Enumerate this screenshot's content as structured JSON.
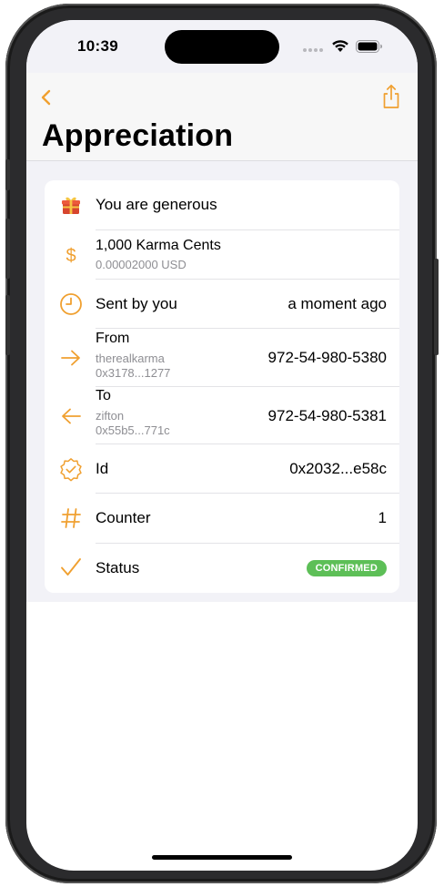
{
  "status_bar": {
    "time": "10:39"
  },
  "nav": {
    "back_icon": "chevron-left-icon",
    "share_icon": "share-icon",
    "title": "Appreciation",
    "accent_color": "#f0a030"
  },
  "details": {
    "header": {
      "icon": "gift-icon",
      "text": "You are generous"
    },
    "amount": {
      "icon": "dollar-sign-icon",
      "primary": "1,000 Karma Cents",
      "secondary": "0.00002000 USD"
    },
    "sent": {
      "icon": "clock-icon",
      "label": "Sent by you",
      "value": "a moment ago"
    },
    "from": {
      "icon": "arrow-right-icon",
      "label": "From",
      "name": "therealkarma",
      "address": "0x3178...1277",
      "phone": "972-54-980-5380"
    },
    "to": {
      "icon": "arrow-left-icon",
      "label": "To",
      "name": "zifton",
      "address": "0x55b5...771c",
      "phone": "972-54-980-5381"
    },
    "id": {
      "icon": "verified-badge-icon",
      "label": "Id",
      "value": "0x2032...e58c"
    },
    "counter": {
      "icon": "hash-icon",
      "label": "Counter",
      "value": "1"
    },
    "status": {
      "icon": "checkmark-icon",
      "label": "Status",
      "badge": "CONFIRMED",
      "badge_color": "#5dbf57"
    }
  }
}
